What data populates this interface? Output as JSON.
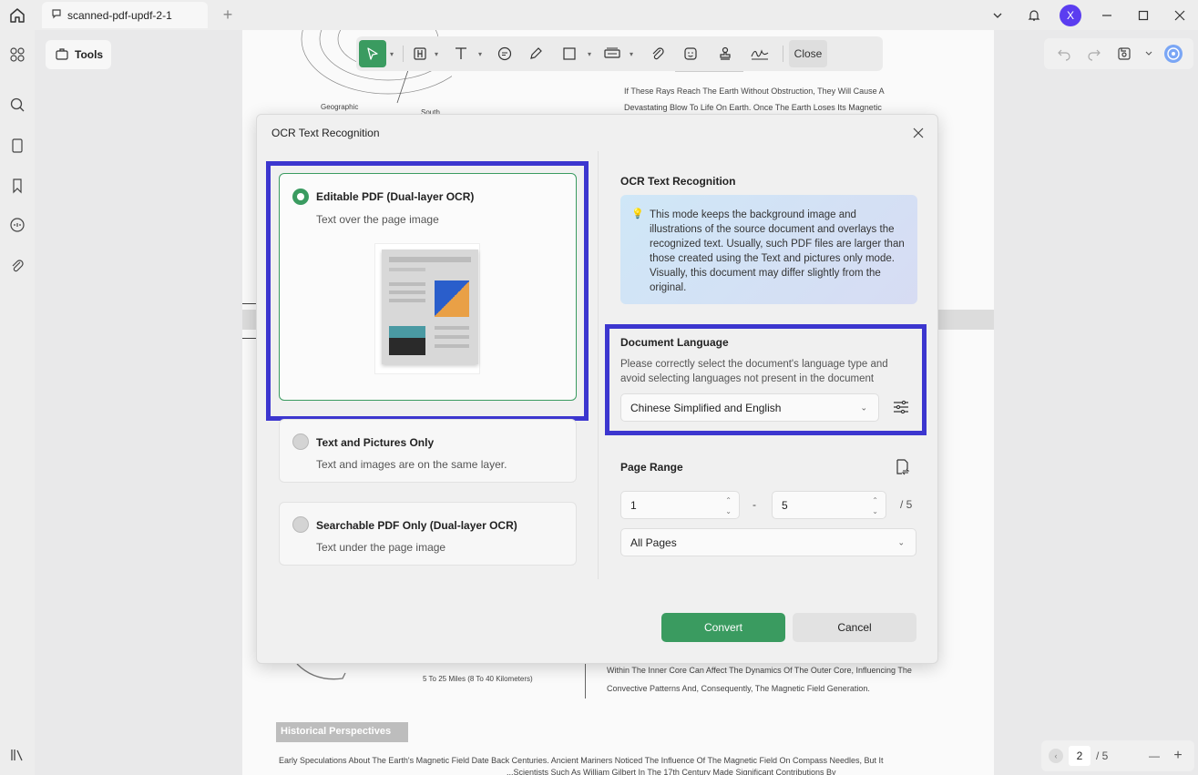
{
  "titlebar": {
    "tab_title": "scanned-pdf-updf-2-1",
    "avatar_letter": "X"
  },
  "tools_panel": {
    "tools_label": "Tools"
  },
  "toolbar": {
    "close_label": "Close"
  },
  "document": {
    "text_lines": [
      "If These Rays Reach The Earth Without Obstruction, They Will Cause A",
      "Devastating Blow To Life On Earth. Once The Earth Loses Its Magnetic",
      "Within The Inner Core Can Affect The Dynamics Of The Outer Core, Influencing The",
      "Convective Patterns And, Consequently, The Magnetic Field Generation.",
      "Early Speculations About The Earth's Magnetic Field Date Back Centuries. Ancient Mariners Noticed The Influence Of The Magnetic Field On Compass Needles, But It",
      "...Scientists Such As William Gilbert In The 17th Century Made Significant Contributions By"
    ],
    "figure_label_geographic": "Geographic",
    "figure_label_south": "South",
    "figure_label_miles": "5 To 25 Miles (8 To 40 Kilometers)",
    "section_heading": "Historical Perspectives"
  },
  "pager": {
    "current": "2",
    "total": "/ 5"
  },
  "modal": {
    "title": "OCR Text Recognition",
    "options": [
      {
        "title": "Editable PDF (Dual-layer OCR)",
        "subtitle": "Text over the page image",
        "selected": true
      },
      {
        "title": "Text and Pictures Only",
        "subtitle": "Text and images are on the same layer.",
        "selected": false
      },
      {
        "title": "Searchable PDF Only (Dual-layer OCR)",
        "subtitle": "Text under the page image",
        "selected": false
      }
    ],
    "right_title": "OCR Text Recognition",
    "info_text": "This mode keeps the background image and illustrations of the source document and overlays the recognized text. Usually, such PDF files are larger than those created using the Text and pictures only mode. Visually, this document may differ slightly from the original.",
    "language": {
      "title": "Document Language",
      "description": "Please correctly select the document's language type and avoid selecting languages not present in the document",
      "selected": "Chinese Simplified and English"
    },
    "page_range": {
      "title": "Page Range",
      "from": "1",
      "to": "5",
      "separator": "-",
      "total": "/ 5",
      "subset": "All Pages"
    },
    "convert_label": "Convert",
    "cancel_label": "Cancel"
  },
  "colors": {
    "accent_green": "#3a9b60",
    "highlight_blue": "#3c36cf",
    "avatar_purple": "#5b3df0"
  }
}
